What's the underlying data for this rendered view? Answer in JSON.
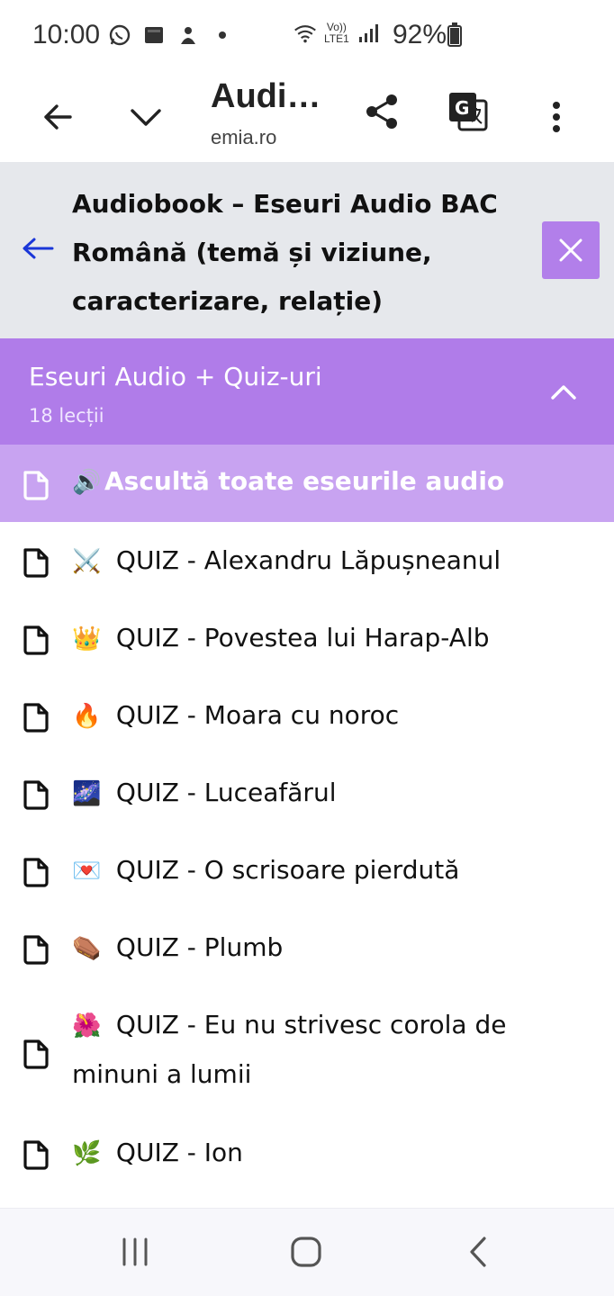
{
  "status_bar": {
    "time": "10:00",
    "battery_percent": "92%",
    "network_label": "LTE1",
    "icons": [
      "whatsapp-icon",
      "image-icon",
      "notification-icon",
      "dot-icon",
      "wifi-icon",
      "volte-icon",
      "signal-icon",
      "battery-icon"
    ]
  },
  "toolbar": {
    "title": "Audi…",
    "url": "emia.ro",
    "icons": [
      "back-arrow-icon",
      "chevron-down-icon",
      "share-icon",
      "translate-icon",
      "more-vert-icon"
    ]
  },
  "lesson_header": {
    "title": "Audiobook – Eseuri Audio BAC Română (temă și viziune, caracterizare, relație)",
    "accent_color": "#b27fea"
  },
  "section": {
    "title": "Eseuri Audio + Quiz-uri",
    "count": "18 lecții",
    "color": "#b07ce9"
  },
  "active_lesson": {
    "emoji": "🔊",
    "label": "Ascultă toate eseurile audio"
  },
  "lessons": [
    {
      "emoji": "⚔️",
      "label": "QUIZ - Alexandru Lăpușneanul"
    },
    {
      "emoji": "👑",
      "label": "QUIZ - Povestea lui Harap-Alb"
    },
    {
      "emoji": "🔥",
      "label": "QUIZ - Moara cu noroc"
    },
    {
      "emoji": "🌌",
      "label": "QUIZ - Luceafărul"
    },
    {
      "emoji": "💌",
      "label": "QUIZ - O scrisoare pierdută"
    },
    {
      "emoji": "⚰️",
      "label": "QUIZ - Plumb"
    },
    {
      "emoji": "🌺",
      "label": "QUIZ - Eu nu strivesc corola de minuni a lumii"
    },
    {
      "emoji": "🌿",
      "label": "QUIZ - Ion"
    }
  ],
  "nav_bar": {
    "icons": [
      "recent-apps-icon",
      "home-icon",
      "back-icon"
    ]
  }
}
